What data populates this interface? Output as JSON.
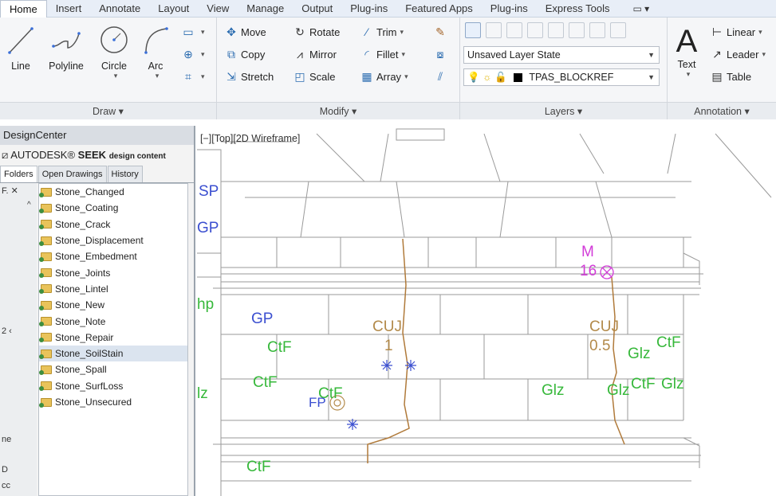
{
  "tabs": {
    "items": [
      "Home",
      "Insert",
      "Annotate",
      "Layout",
      "View",
      "Manage",
      "Output",
      "Plug-ins",
      "Featured Apps",
      "Plug-ins",
      "Express Tools"
    ],
    "active": "Home"
  },
  "draw_panel": {
    "title": "Draw ▾",
    "tools": [
      "Line",
      "Polyline",
      "Circle",
      "Arc"
    ]
  },
  "modify_panel": {
    "title": "Modify ▾",
    "col1": [
      "Move",
      "Copy",
      "Stretch"
    ],
    "col2": [
      "Rotate",
      "Mirror",
      "Scale"
    ],
    "col3": [
      "Trim",
      "Fillet",
      "Array"
    ]
  },
  "layers_panel": {
    "title": "Layers ▾",
    "layer_state": "Unsaved Layer State",
    "current_layer": "TPAS_BLOCKREF"
  },
  "annotation_panel": {
    "title": "Annotation ▾",
    "text_tool": "Text",
    "tools": [
      "Linear",
      "Leader",
      "Table"
    ]
  },
  "design_center": {
    "title": "DesignCenter",
    "logo": "AUTODESK",
    "logo_seek": "SEEK",
    "logo_tail": "design content",
    "tabs": [
      "Folders",
      "Open Drawings",
      "History"
    ],
    "side_label": "F. ✕",
    "items": [
      "Stone_Changed",
      "Stone_Coating",
      "Stone_Crack",
      "Stone_Displacement",
      "Stone_Embedment",
      "Stone_Joints",
      "Stone_Lintel",
      "Stone_New",
      "Stone_Note",
      "Stone_Repair",
      "Stone_SoilStain",
      "Stone_Spall",
      "Stone_SurfLoss",
      "Stone_Unsecured"
    ],
    "selected": "Stone_SoilStain",
    "side_fragments": [
      "2 ‹",
      "ne",
      "D",
      "cc"
    ]
  },
  "drawing": {
    "viewport_label": "[−][Top][2D Wireframe]",
    "labels": {
      "sp": "SP",
      "gp_left": "GP",
      "hp": "hp",
      "lz": "lz",
      "gp_center": "GP",
      "ctf1": "CtF",
      "ctf2": "CtF",
      "ctf3": "CtF",
      "ctf_bottom": "CtF",
      "fp": "FP",
      "cuj1": "CUJ",
      "cuj1_val": "1",
      "m": "M",
      "m_val": "16",
      "cuj2": "CUJ",
      "cuj2_val": "0.5",
      "glz1": "Glz",
      "ctf_r1": "CtF",
      "glz2": "Glz",
      "glz3": "Glz",
      "ctf_r2": "CtF",
      "glz4": "Glz"
    }
  },
  "colors": {
    "cad_green": "#36b83a",
    "cad_blue": "#3b4fd0",
    "cad_magenta": "#d23bd8",
    "cad_tan": "#b38a4a",
    "crack": "#b07a3a"
  }
}
